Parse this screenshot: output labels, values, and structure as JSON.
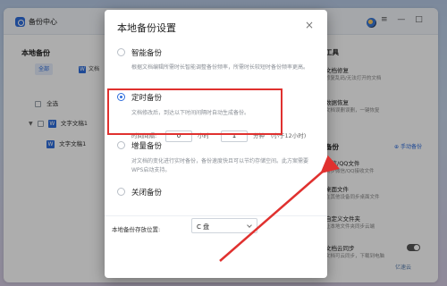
{
  "app": {
    "title": "备份中心",
    "window_controls": "≡ — □"
  },
  "left_panel": {
    "title": "本地备份",
    "filter_all": "全部",
    "filter_doc": "文档",
    "select_all": "全选",
    "tree": [
      {
        "label": "文字文稿1",
        "expanded": true
      },
      {
        "label": "文字文稿1"
      }
    ]
  },
  "right_panel": {
    "tools_title": "备份工具",
    "tools": [
      {
        "title": "文档修复",
        "subtitle": "修复乱码/无法打开的文档",
        "color": "#2f6ddc"
      },
      {
        "title": "数据恢复",
        "subtitle": "文档误删误删，一键恢复",
        "color": "#7b5ad6"
      }
    ],
    "cloud_title": "云端备份",
    "manual_backup": "手动备份",
    "cloud_items": [
      {
        "title": "微信/QQ文件",
        "subtitle": "同步微信/QQ接收文件",
        "color": "#3bb54a"
      },
      {
        "title": "桌面文件",
        "subtitle": "在其他设备同步桌面文件",
        "color": "#2f6ddc"
      },
      {
        "title": "自定义文件夹",
        "subtitle": "让本地文件夹同步云端",
        "color": "#f0a030"
      },
      {
        "title": "文档云同步",
        "subtitle": "文档可云同步，下载到电脑",
        "color": "#2f6ddc"
      }
    ],
    "cloud_sync_enabled": true
  },
  "modal": {
    "title": "本地备份设置",
    "close": "×",
    "options": [
      {
        "label": "智能备份",
        "desc": "根据文档编辑所需时长智能调整备份频率，所需时长较短时备份频率更高。",
        "selected": false
      },
      {
        "label": "定时备份",
        "desc": "文档修改后，到达以下时间间隔时自动生成备份。",
        "selected": true
      },
      {
        "label": "增量备份",
        "desc": "对文档的变化进行实时备份，备份速度快且可以节约存储空间。此方案需要WPS启动支持。",
        "selected": false
      },
      {
        "label": "关闭备份",
        "desc": "",
        "selected": false
      }
    ],
    "interval": {
      "label": "时间间隔:",
      "hours": "0",
      "hours_unit": "小时",
      "minutes": "1",
      "minutes_unit": "分钟",
      "hint": "(小于12小时)"
    },
    "location_label": "本地备份存放位置:",
    "location_value": "C 盘"
  },
  "watermark": "亿速云"
}
